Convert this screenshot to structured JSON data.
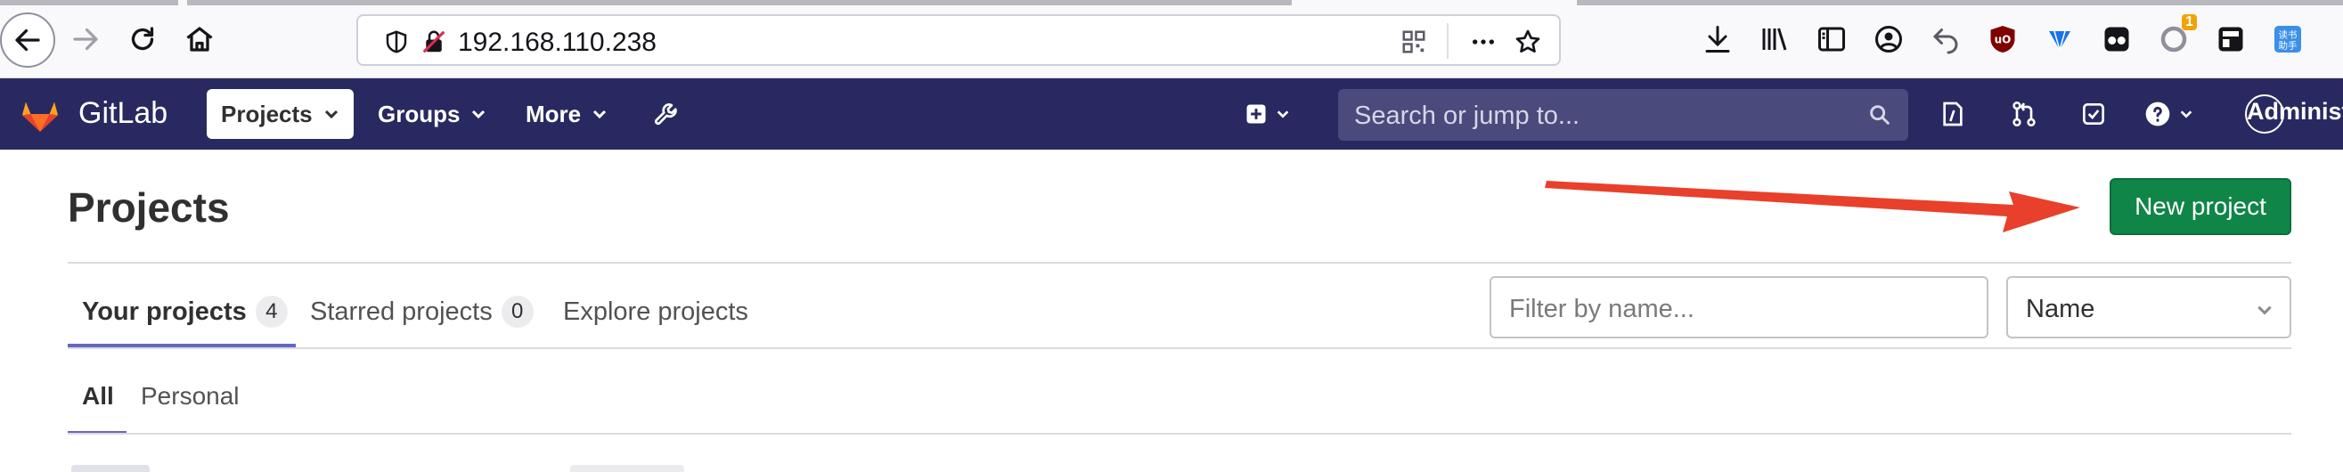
{
  "browser": {
    "url": "192.168.110.238",
    "icons": [
      "back-icon",
      "forward-icon",
      "reload-icon",
      "home-icon",
      "shield-icon",
      "insecure-lock-icon",
      "qr-code-icon",
      "more-icon",
      "star-icon",
      "download-icon",
      "library-icon",
      "sidebar-icon",
      "account-icon",
      "undo-icon",
      "ublock-icon",
      "extension-diamond-icon",
      "extension-glasses-icon",
      "extension-badge-icon",
      "extension-calc-icon",
      "extension-reader-icon"
    ],
    "extension_badge": "1",
    "reader_label": "读书助手"
  },
  "gitlab_nav": {
    "brand": "GitLab",
    "projects": "Projects",
    "groups": "Groups",
    "more": "More",
    "search_placeholder": "Search or jump to...",
    "user": "Administrator",
    "colors": {
      "nav_bg": "#292961",
      "search_bg": "#4a4a7c"
    }
  },
  "page": {
    "title": "Projects",
    "new_project": "New project",
    "tabs": [
      {
        "label": "Your projects",
        "count": "4",
        "active": true
      },
      {
        "label": "Starred projects",
        "count": "0",
        "active": false
      },
      {
        "label": "Explore projects",
        "count": "",
        "active": false
      }
    ],
    "filter_placeholder": "Filter by name...",
    "sort_value": "Name",
    "subtabs": [
      {
        "label": "All",
        "active": true
      },
      {
        "label": "Personal",
        "active": false
      }
    ],
    "colors": {
      "primary_button": "#108548",
      "tab_underline": "#6666c4",
      "annotation_arrow": "#e8402b"
    }
  }
}
